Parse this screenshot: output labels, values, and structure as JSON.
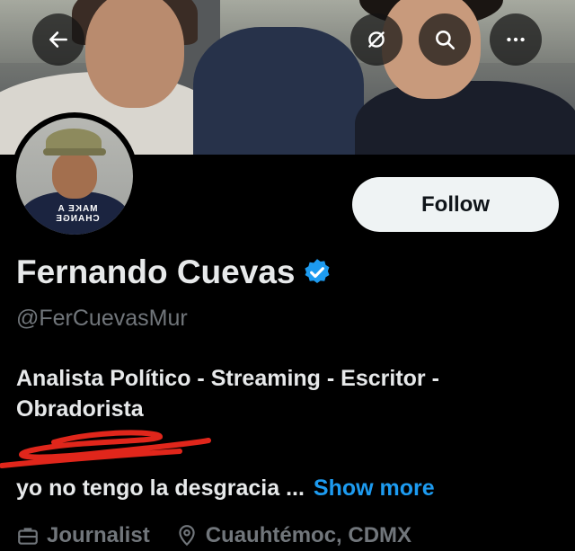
{
  "header": {
    "back_icon": "arrow-left-icon",
    "actions": [
      {
        "name": "sync-icon"
      },
      {
        "name": "search-icon"
      },
      {
        "name": "more-icon"
      }
    ]
  },
  "profile": {
    "follow_label": "Follow",
    "display_name": "Fernando Cuevas",
    "handle": "@FerCuevasMur",
    "verified_color": "#1d9bf0",
    "bio_line1": "Analista Político - Streaming - Escritor -",
    "bio_line2": "Obradorista",
    "description_truncated": "yo no tengo la desgracia ...",
    "show_more_label": "Show more",
    "category": "Journalist",
    "location": "Cuauhtémoc, CDMX",
    "avatar_shirt_text": "MAKE A CHANGE"
  },
  "colors": {
    "background": "#000000",
    "accent": "#1d9bf0",
    "secondary_text": "#71767b",
    "scribble": "#e0261b"
  }
}
